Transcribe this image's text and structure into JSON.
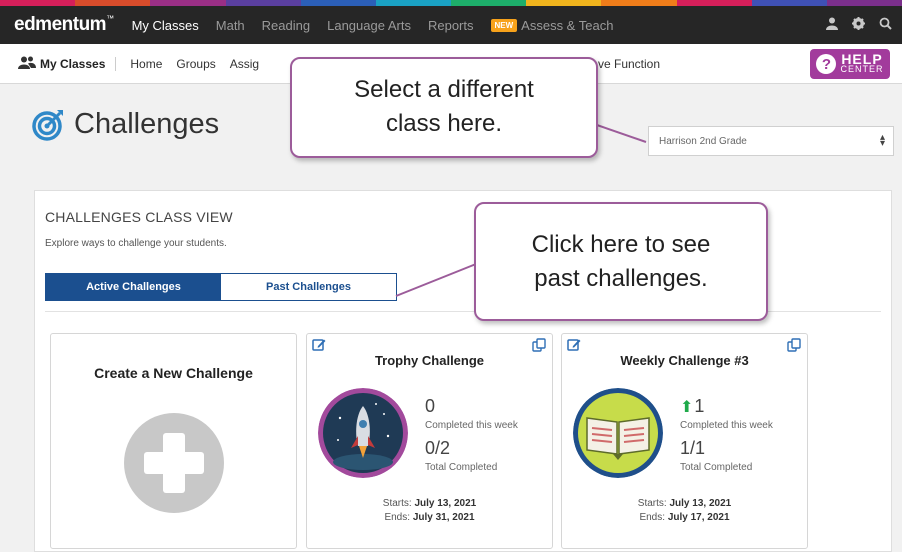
{
  "colors": {
    "stripes": [
      "#d51f5a",
      "#d84c2b",
      "#9a2f86",
      "#5a3fa0",
      "#2b5fb8",
      "#1aa1c3",
      "#1eae6a",
      "#f0b41d",
      "#ef7d1a",
      "#d51f5a",
      "#3f51b5",
      "#7b2f8c"
    ],
    "nav_bg": "#262626",
    "accent_blue": "#1b4f8f",
    "help_purple": "#a23b9c",
    "callout_border": "#9c5c9a"
  },
  "topnav": {
    "brand": "edmentum",
    "brand_mark": "™",
    "items": [
      {
        "label": "My Classes",
        "active": true
      },
      {
        "label": "Math",
        "active": false
      },
      {
        "label": "Reading",
        "active": false
      },
      {
        "label": "Language Arts",
        "active": false
      },
      {
        "label": "Reports",
        "active": false
      }
    ],
    "new_badge": "NEW",
    "assess_label": "Assess & Teach",
    "icons": [
      "user-icon",
      "gear-icon",
      "search-icon"
    ]
  },
  "subnav": {
    "title": "My Classes",
    "items": [
      "Home",
      "Groups",
      "Assig"
    ],
    "partial_item": "ve Function",
    "help": {
      "line1": "HELP",
      "line2": "CENTER"
    }
  },
  "page": {
    "title": "Challenges",
    "class_selector": {
      "selected": "Harrison 2nd Grade"
    }
  },
  "panel": {
    "heading": "CHALLENGES CLASS VIEW",
    "description": "Explore ways to challenge your students.",
    "tabs": [
      {
        "label": "Active Challenges",
        "active": true
      },
      {
        "label": "Past Challenges",
        "active": false
      }
    ]
  },
  "cards": {
    "create": {
      "title": "Create a New Challenge"
    },
    "trophy": {
      "title": "Trophy Challenge",
      "week_count": "0",
      "week_label": "Completed this week",
      "total": "0/2",
      "total_label": "Total Completed",
      "starts_label": "Starts:",
      "starts": "July 13, 2021",
      "ends_label": "Ends:",
      "ends": "July 31, 2021"
    },
    "weekly": {
      "title": "Weekly Challenge #3",
      "week_count": "1",
      "week_label": "Completed this week",
      "total": "1/1",
      "total_label": "Total Completed",
      "starts_label": "Starts:",
      "starts": "July 13, 2021",
      "ends_label": "Ends:",
      "ends": "July 17, 2021"
    }
  },
  "callouts": {
    "select_class": {
      "line1": "Select a different",
      "line2": "class here."
    },
    "past": {
      "line1": "Click here to see",
      "line2": "past challenges."
    }
  }
}
